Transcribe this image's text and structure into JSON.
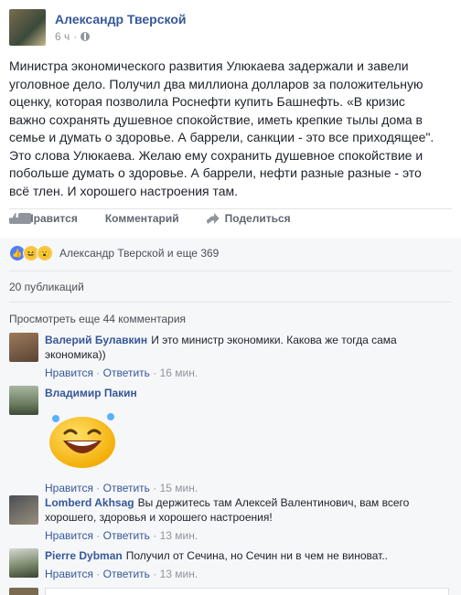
{
  "post": {
    "author": "Александр Тверской",
    "time": "6 ч",
    "text": "Министра экономического развития Улюкаева задержали и завели уголовное дело. Получил два миллиона долларов за положительную оценку, которая позволила Роснефти купить Башнефть. «В кризис важно сохранять душевное спокойствие, иметь крепкие тылы дома в семье и думать о здоровье. А баррели, санкции - это все приходящее\". Это слова Улюкаева. Желаю ему сохранить душевное спокойствие и побольше думать о здоровье. А баррели, нефти разные разные - это всё тлен. И хорошего настроения там."
  },
  "actions": {
    "like": "Нравится",
    "comment": "Комментарий",
    "share": "Поделиться"
  },
  "reactions": {
    "text": "Александр Тверской и еще 369"
  },
  "shares": "20 публикаций",
  "more_comments": "Просмотреть еще 44 комментария",
  "comments": [
    {
      "name": "Валерий Булавкин",
      "text": "И это министр экономики. Какова же тогда сама экономика))",
      "like": "Нравится",
      "reply": "Ответить",
      "time": "16 мин."
    },
    {
      "name": "Владимир Пакин",
      "text": "",
      "like": "Нравится",
      "reply": "Ответить",
      "time": "15 мин."
    },
    {
      "name": "Lomberd Akhsag",
      "text": "Вы держитесь там Алексей Валентинович, вам всего хорошего, здоровья и хорошего настроения!",
      "like": "Нравится",
      "reply": "Ответить",
      "time": "13 мин."
    },
    {
      "name": "Pierre Dybman",
      "text": "Получил от Сечина, но Сечин ни в чем не виноват..",
      "like": "Нравится",
      "reply": "Ответить",
      "time": "13 мин."
    }
  ],
  "sep": "·"
}
